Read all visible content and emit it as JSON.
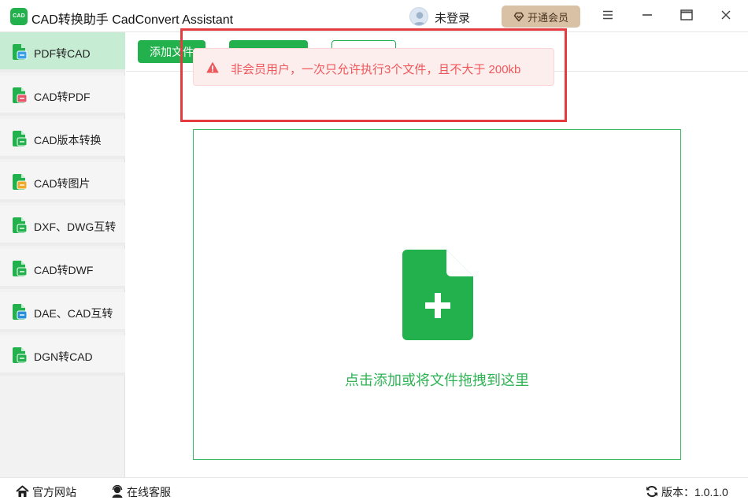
{
  "titlebar": {
    "logo_text": "CAD",
    "title": "CAD转换助手 CadConvert Assistant",
    "login_label": "未登录",
    "vip_label": "开通会员"
  },
  "sidebar": {
    "items": [
      {
        "label": "PDF转CAD",
        "icon": "pdf-to-cad-icon",
        "active": true
      },
      {
        "label": "CAD转PDF",
        "icon": "cad-to-pdf-icon",
        "active": false
      },
      {
        "label": "CAD版本转换",
        "icon": "cad-version-icon",
        "active": false
      },
      {
        "label": "CAD转图片",
        "icon": "cad-to-image-icon",
        "active": false
      },
      {
        "label": "DXF、DWG互转",
        "icon": "dxf-dwg-icon",
        "active": false
      },
      {
        "label": "CAD转DWF",
        "icon": "cad-to-dwf-icon",
        "active": false
      },
      {
        "label": "DAE、CAD互转",
        "icon": "dae-cad-icon",
        "active": false
      },
      {
        "label": "DGN转CAD",
        "icon": "dgn-to-cad-icon",
        "active": false
      }
    ]
  },
  "toolbar": {
    "add_file_label": "添加文件"
  },
  "toast": {
    "message": "非会员用户，一次只允许执行3个文件，且不大于 200kb"
  },
  "dropzone": {
    "hint": "点击添加或将文件拖拽到这里"
  },
  "footer": {
    "website_label": "官方网站",
    "service_label": "在线客服",
    "version_label": "版本：1.0.1.0"
  },
  "colors": {
    "accent": "#22b14c",
    "active_item_bg": "#c6ecd4",
    "warning_text": "#f0575b",
    "warning_bg": "#fdeeee",
    "highlight_border": "#e33b3f",
    "vip_bg": "#d9c1a6"
  }
}
